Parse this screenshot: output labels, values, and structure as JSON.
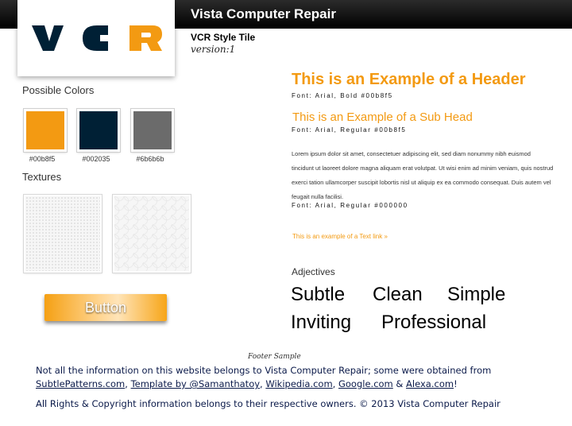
{
  "header": {
    "title": "Vista Computer Repair"
  },
  "logo": {
    "letters": [
      "V",
      "C",
      "R"
    ],
    "colors": [
      "#002035",
      "#002035",
      "#00b8f5"
    ]
  },
  "tile": {
    "name": "VCR Style Tile",
    "version": "version:1"
  },
  "colors_section": {
    "label": "Possible Colors",
    "swatches": [
      {
        "hex": "#00b8f5",
        "display": "#f39a12",
        "label": "#00b8f5"
      },
      {
        "hex": "#002035",
        "display": "#002035",
        "label": "#002035"
      },
      {
        "hex": "#6b6b6b",
        "display": "#6b6b6b",
        "label": "#6b6b6b"
      }
    ]
  },
  "textures_section": {
    "label": "Textures"
  },
  "button": {
    "label": "Button"
  },
  "typography": {
    "header_example": "This is an Example of a Header",
    "header_font": "Font: Arial, Bold #00b8f5",
    "subhead_example": "This is an Example of a Sub Head",
    "subhead_font": "Font: Arial, Regular #00b8f5",
    "body_text": "Lorem ipsum dolor sit amet, consectetuer adipiscing elit, sed diam nonummy nibh euismod tincidunt ut laoreet dolore magna aliquam erat volutpat. Ut wisi enim ad minim veniam, quis nostrud exerci tation ullamcorper suscipit lobortis nisl ut aliquip ex ea commodo consequat. Duis autem vel feugait nulla facilisi.",
    "body_font": "Font: Arial, Regular #000000",
    "link_example": "This is an example of a Text link »"
  },
  "adjectives": {
    "label": "Adjectives",
    "words": [
      "Subtle",
      "Clean",
      "Simple",
      "Inviting",
      "Professional"
    ]
  },
  "footer": {
    "sample_label": "Footer Sample",
    "line1": "Not all the information on this website belongs to Vista Computer Repair; some were obtained from",
    "links": [
      "SubtlePatterns.com",
      "Template by @Samanthatoy",
      "Wikipedia.com",
      "Google.com",
      "Alexa.com"
    ],
    "sep_comma": ", ",
    "sep_amp": " & ",
    "end_mark": "!",
    "line3": "All Rights & Copyright information belongs to their respective owners. © 2013 Vista Computer Repair"
  }
}
